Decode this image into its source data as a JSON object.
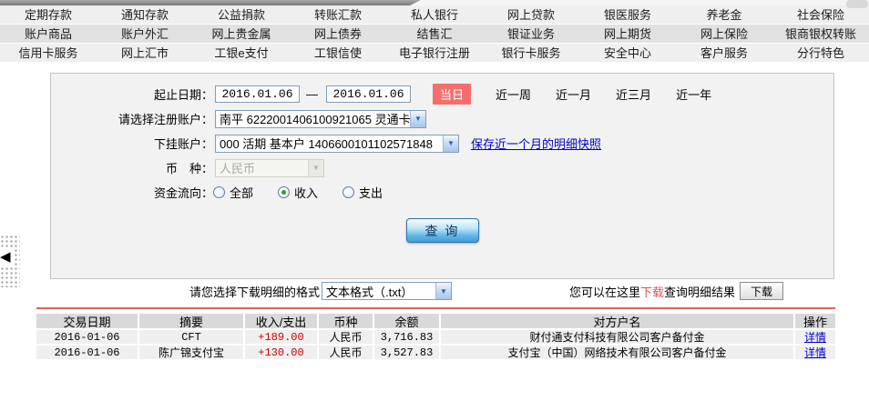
{
  "nav": {
    "rows": [
      [
        "定期存款",
        "通知存款",
        "公益捐款",
        "转账汇款",
        "私人银行",
        "网上贷款",
        "银医服务",
        "养老金",
        "社会保险"
      ],
      [
        "账户商品",
        "账户外汇",
        "网上贵金属",
        "网上债券",
        "结售汇",
        "银证业务",
        "网上期货",
        "网上保险",
        "银商银权转账"
      ],
      [
        "信用卡服务",
        "网上汇市",
        "工银e支付",
        "工银信使",
        "电子银行注册",
        "银行卡服务",
        "安全中心",
        "客户服务",
        "分行特色"
      ]
    ]
  },
  "form": {
    "date_label": "起止日期：",
    "date_from": "2016.01.06",
    "date_separator": "—",
    "date_to": "2016.01.06",
    "today_badge": "当日",
    "quick_ranges": [
      "近一周",
      "近一月",
      "近三月",
      "近一年"
    ],
    "register_account_label": "请选择注册账户：",
    "register_account_value": "南平 6222001406100921065 灵通卡",
    "sub_account_label": "下挂账户：",
    "sub_account_value": "000 活期 基本户 1406600101102571848",
    "snapshot_link": "保存近一个月的明细快照",
    "currency_label": "币　种：",
    "currency_value": "人民币",
    "flow_label": "资金流向：",
    "flow_options": [
      "全部",
      "收入",
      "支出"
    ],
    "flow_selected": "收入",
    "query_button": "查 询"
  },
  "download": {
    "format_label": "请您选择下载明细的格式",
    "format_value": "文本格式（.txt）",
    "hint_prefix": "您可以在这里",
    "hint_link": "下载",
    "hint_suffix": "查询明细结果",
    "download_button": "下载"
  },
  "table": {
    "headers": [
      "交易日期",
      "摘要",
      "收入/支出",
      "币种",
      "余额",
      "对方户名",
      "操作"
    ],
    "rows": [
      {
        "date": "2016-01-06",
        "summary": "CFT",
        "amount": "+189.00",
        "currency": "人民币",
        "balance": "3,716.83",
        "counterparty": "财付通支付科技有限公司客户备付金",
        "action": "详情"
      },
      {
        "date": "2016-01-06",
        "summary": "陈广锦支付宝",
        "amount": "+130.00",
        "currency": "人民币",
        "balance": "3,527.83",
        "counterparty": "支付宝（中国）网络技术有限公司客户备付金",
        "action": "详情"
      }
    ]
  },
  "icons": {
    "dropdown_arrow": "▼",
    "collapse_left": "◀"
  },
  "colors": {
    "badge_red": "#f56e6e",
    "divider_red": "#e0605a",
    "amount_red": "#cc0000",
    "link_blue": "#0000cc",
    "button_blue": "#3f9eda",
    "panel_gray": "#f2f2f2",
    "header_gray": "#d9d9d9"
  }
}
